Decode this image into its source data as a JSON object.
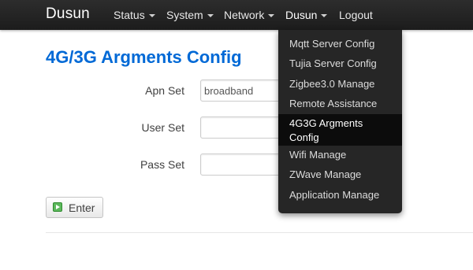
{
  "navbar": {
    "brand": "Dusun",
    "items": [
      {
        "label": "Status",
        "has_caret": true
      },
      {
        "label": "System",
        "has_caret": true
      },
      {
        "label": "Network",
        "has_caret": true
      },
      {
        "label": "Dusun",
        "has_caret": true,
        "open": true
      },
      {
        "label": "Logout",
        "has_caret": false
      }
    ]
  },
  "dropdown": {
    "items": [
      {
        "label": "Mqtt Server Config"
      },
      {
        "label": "Tujia Server Config"
      },
      {
        "label": "Zigbee3.0 Manage"
      },
      {
        "label": "Remote Assistance"
      },
      {
        "label": "4G3G Argments Config",
        "active": true
      },
      {
        "label": "Wifi Manage"
      },
      {
        "label": "ZWave Manage"
      },
      {
        "label": "Application Manage"
      }
    ]
  },
  "page": {
    "title": "4G/3G Argments Config"
  },
  "form": {
    "apn": {
      "label": "Apn Set",
      "value": "broadband"
    },
    "user": {
      "label": "User Set",
      "value": ""
    },
    "pass": {
      "label": "Pass Set",
      "value": ""
    },
    "enter_label": "Enter"
  },
  "colors": {
    "navbar_bg": "#222222",
    "title": "#0069d6",
    "dropdown_bg": "#262626",
    "dropdown_active": "#0c0c0c",
    "enter_icon": "#5cb85c"
  },
  "icons": {
    "enter": "play-arrow-icon",
    "caret": "caret-down-icon"
  }
}
